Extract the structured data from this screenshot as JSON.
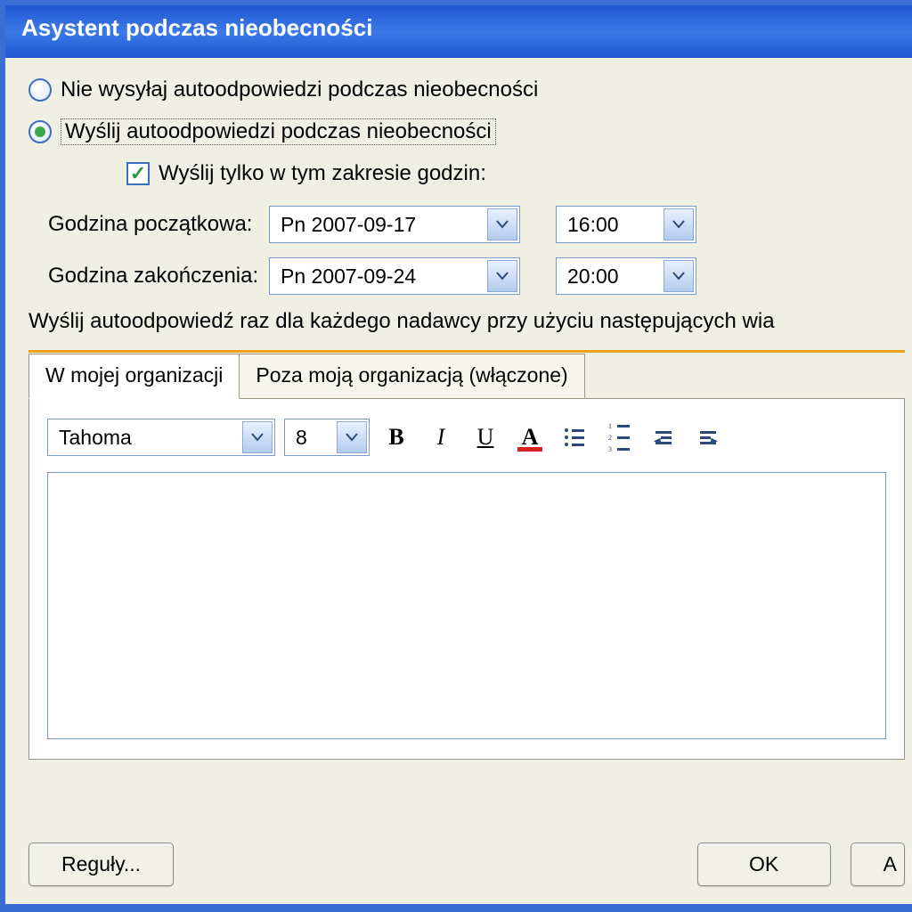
{
  "window": {
    "title": "Asystent podczas nieobecności"
  },
  "radios": {
    "do_not_send": "Nie wysyłaj autoodpowiedzi podczas nieobecności",
    "send": "Wyślij autoodpowiedzi podczas nieobecności",
    "selected": "send"
  },
  "range_check": {
    "label": "Wyślij tylko w tym zakresie godzin:",
    "checked": true
  },
  "time": {
    "start_label": "Godzina początkowa:",
    "start_date": "Pn 2007-09-17",
    "start_time": "16:00",
    "end_label": "Godzina zakończenia:",
    "end_date": "Pn 2007-09-24",
    "end_time": "20:00"
  },
  "instruction": "Wyślij autoodpowiedź raz dla każdego nadawcy przy użyciu następujących wia",
  "tabs": {
    "inside": "W mojej organizacji",
    "outside": "Poza moją organizacją (włączone)",
    "active": "inside"
  },
  "toolbar": {
    "font": "Tahoma",
    "size": "8",
    "bold": "B",
    "italic": "I",
    "underline": "U",
    "color_letter": "A"
  },
  "buttons": {
    "rules": "Reguły...",
    "ok": "OK",
    "anuluj": "A"
  },
  "icons": {
    "chevron_down": "chevron-down-icon",
    "checkmark": "checkmark-icon",
    "radio_dot": "radio-dot-icon",
    "bullet_list": "bullet-list-icon",
    "number_list": "numbered-list-icon",
    "outdent": "decrease-indent-icon",
    "indent": "increase-indent-icon"
  }
}
